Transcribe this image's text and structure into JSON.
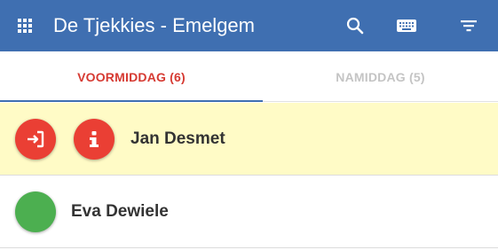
{
  "appbar": {
    "title": "De Tjekkies - Emelgem",
    "background": "#3f6fb1",
    "icons": [
      "apps-icon",
      "search-icon",
      "keyboard-icon",
      "filter-icon"
    ]
  },
  "tabs": [
    {
      "label": "VOORMIDDAG (6)",
      "active": true,
      "color": "#d63a32"
    },
    {
      "label": "NAMIDDAG (5)",
      "active": false,
      "color": "#c4c4c4"
    }
  ],
  "rows": [
    {
      "name": "Jan Desmet",
      "highlight": "#fffbc6",
      "status_icons": [
        "check-in-icon",
        "info-icon"
      ],
      "status_color": "#ea3f34"
    },
    {
      "name": "Eva Dewiele",
      "highlight": "#ffffff",
      "status_icons": [
        "status-dot-icon"
      ],
      "status_color": "#4caf50"
    }
  ]
}
